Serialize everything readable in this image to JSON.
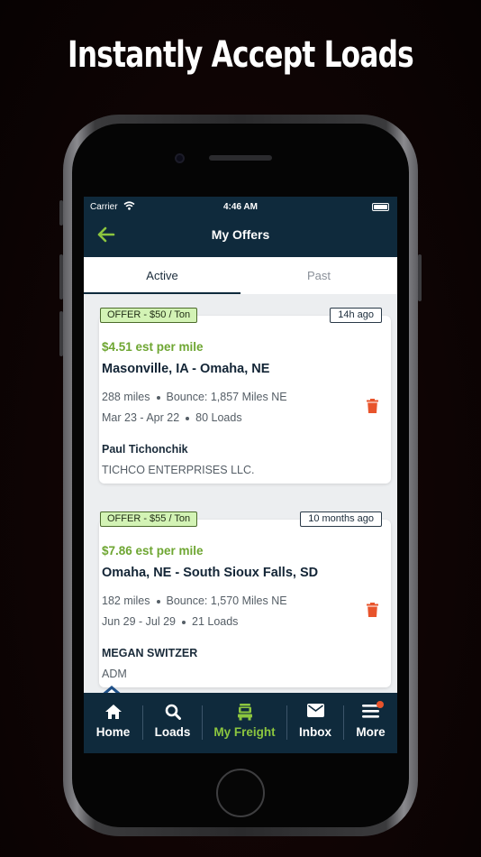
{
  "headline": "Instantly Accept Loads",
  "status_bar": {
    "carrier": "Carrier",
    "time": "4:46 AM"
  },
  "header": {
    "title": "My Offers",
    "back_icon": "back-arrow-icon"
  },
  "tabs": [
    {
      "label": "Active",
      "selected": true
    },
    {
      "label": "Past",
      "selected": false
    }
  ],
  "offers": [
    {
      "badge": "OFFER - $50 / Ton",
      "age": "14h ago",
      "rate": "$4.51 est per mile",
      "route": "Masonville, IA - Omaha, NE",
      "miles": "288 miles",
      "bounce": "Bounce: 1,857 Miles NE",
      "dates": "Mar 23 - Apr 22",
      "loads": "80 Loads",
      "contact": "Paul Tichonchik",
      "company": "TICHCO ENTERPRISES LLC."
    },
    {
      "badge": "OFFER - $55 / Ton",
      "age": "10 months ago",
      "rate": "$7.86 est per mile",
      "route": "Omaha, NE - South Sioux Falls, SD",
      "miles": "182 miles",
      "bounce": "Bounce: 1,570 Miles NE",
      "dates": "Jun 29 - Jul 29",
      "loads": "21 Loads",
      "contact": "MEGAN SWITZER",
      "company": "ADM"
    }
  ],
  "tabbar": [
    {
      "label": "Home",
      "icon": "home-icon",
      "active": false
    },
    {
      "label": "Loads",
      "icon": "search-icon",
      "active": false
    },
    {
      "label": "My Freight",
      "icon": "truck-icon",
      "active": true
    },
    {
      "label": "Inbox",
      "icon": "envelope-icon",
      "active": false
    },
    {
      "label": "More",
      "icon": "menu-icon",
      "active": false,
      "notification": true
    }
  ],
  "colors": {
    "navy": "#0f2a3c",
    "accent_green": "#8cc63f",
    "rate_green": "#6ea632",
    "badge_green": "#d3f3b5",
    "delete_orange": "#e8542c"
  }
}
